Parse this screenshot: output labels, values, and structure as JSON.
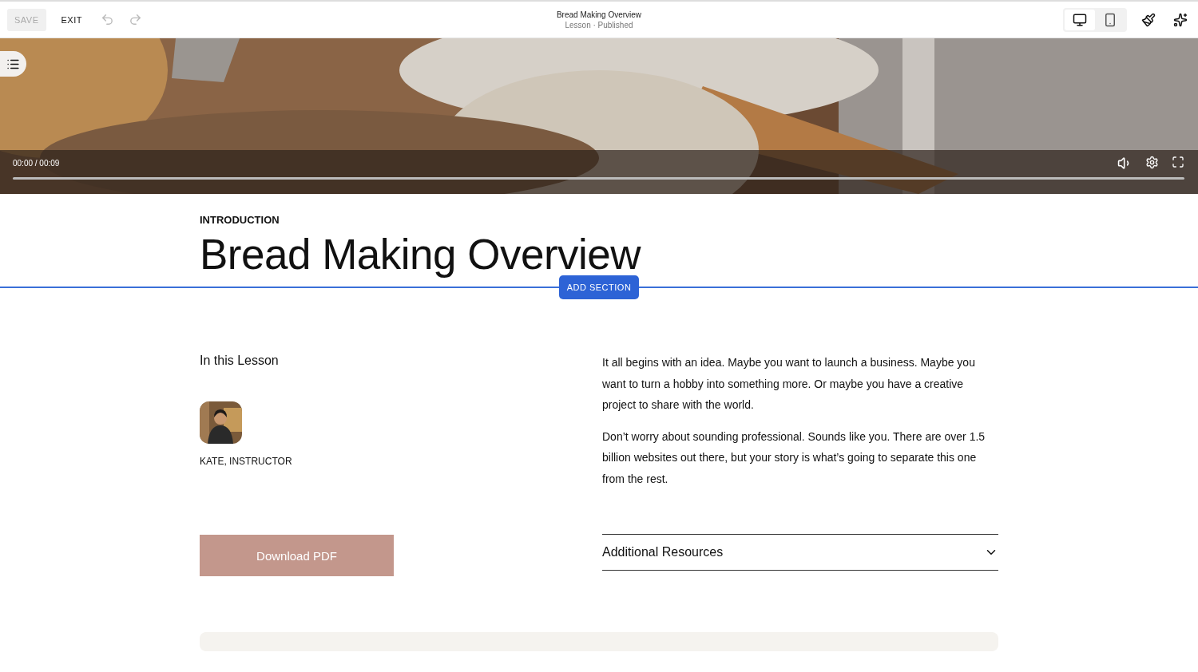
{
  "toolbar": {
    "save": {
      "label": "SAVE",
      "disabled": true
    },
    "exit": {
      "label": "EXIT"
    },
    "undo": {
      "disabled": true
    },
    "redo": {
      "disabled": true
    },
    "title": "Bread Making Overview",
    "subtitle": "Lesson · Published",
    "devices": [
      {
        "kind": "desktop",
        "selected": true
      },
      {
        "kind": "mobile",
        "selected": false
      }
    ]
  },
  "video": {
    "time": "00:00 / 00:09",
    "progress": {
      "level": 0
    }
  },
  "header": {
    "eyebrow": "INTRODUCTION",
    "title": "Bread Making Overview"
  },
  "add_section": "ADD SECTION",
  "lesson": {
    "heading": "In this Lesson",
    "instructor": "KATE, INSTRUCTOR",
    "download": "Download PDF"
  },
  "body": [
    "It all begins with an idea. Maybe you want to launch a business. Maybe you want to turn a hobby into something more. Or maybe you have a creative project to share with the world.",
    "Don’t worry about sounding professional. Sounds like you. There are over 1.5 billion websites out there, but your story is what’s going to separate this one from the rest."
  ],
  "accordion": {
    "label": "Additional Resources",
    "expanded": false
  }
}
